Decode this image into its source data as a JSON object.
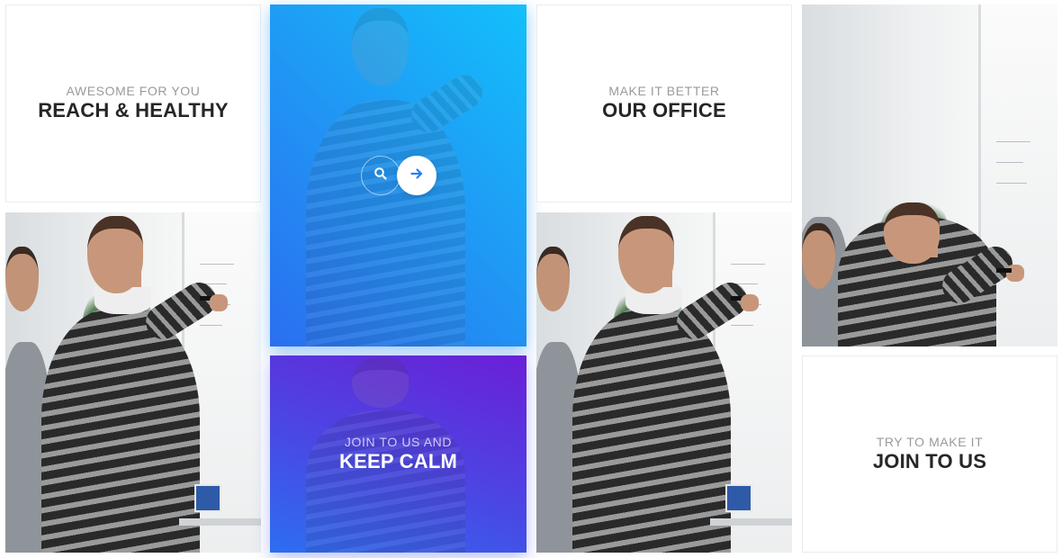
{
  "tiles": {
    "reach_healthy": {
      "subtitle": "AWESOME FOR YOU",
      "title": "REACH & HEALTHY"
    },
    "our_office": {
      "subtitle": "MAKE IT BETTER",
      "title": "OUR OFFICE"
    },
    "keep_calm": {
      "subtitle": "JOIN TO US AND",
      "title": "KEEP CALM"
    },
    "join_to_us": {
      "subtitle": "TRY TO MAKE IT",
      "title": "JOIN TO US"
    }
  },
  "overlay_actions": {
    "search_icon": "search-icon",
    "link_icon": "arrow-right-icon"
  },
  "colors": {
    "blue_gradient_start": "#12c0fb",
    "blue_gradient_end": "#2a6ff0",
    "purple_gradient_start": "#6b1fd6",
    "purple_gradient_end": "#2d6ef0",
    "title_text": "#262626",
    "subtitle_text": "#9a9a9a"
  }
}
